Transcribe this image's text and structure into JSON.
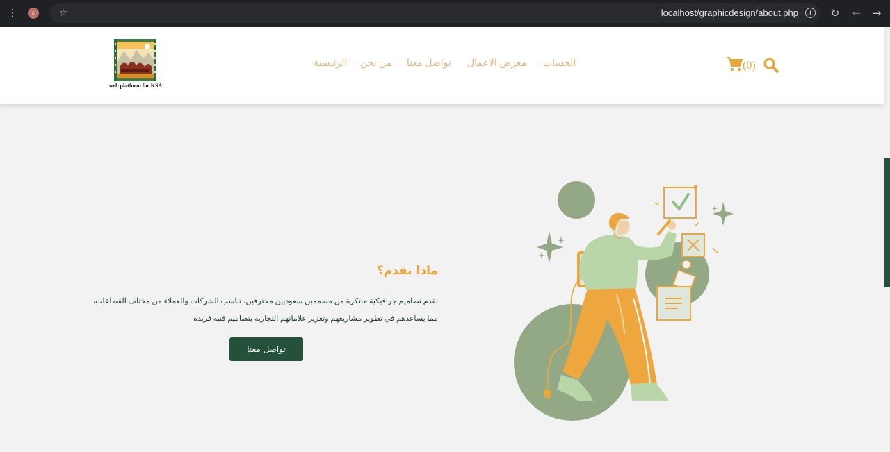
{
  "browser": {
    "url": "localhost/graphicdesign/about.php",
    "profile_initial": "c",
    "menu_glyph": "⋮",
    "bookmark_glyph": "☆",
    "info_glyph": "i",
    "reload_glyph": "↻",
    "back_glyph": "←",
    "forward_glyph": "→"
  },
  "header": {
    "logo_caption": "web platform for KSA",
    "nav": [
      {
        "label": "الحساب"
      },
      {
        "label": "معرض الاعمال"
      },
      {
        "label": "تواصل معنا"
      },
      {
        "label": "من نحن"
      },
      {
        "label": "الرئيسية"
      }
    ],
    "cart_count": "(0)"
  },
  "hero": {
    "title": "ماذا نقدم؟",
    "description": "نقدم تصاميم جرافيكية مبتكرة من مصممين سعوديين محترفين، تناسب الشركات والعملاء من مختلف القطاعات، مما يساعدهم في تطوير مشاريعهم وتعزيز علاماتهم التجارية بتصاميم فنية فريدة",
    "cta_label": "تواصل معنا"
  },
  "colors": {
    "brand_green": "#25513a",
    "accent_orange": "#e8a83e",
    "nav_text": "#e2b37b",
    "illustration_green": "#93a885",
    "light_green": "#b9d6a8"
  }
}
